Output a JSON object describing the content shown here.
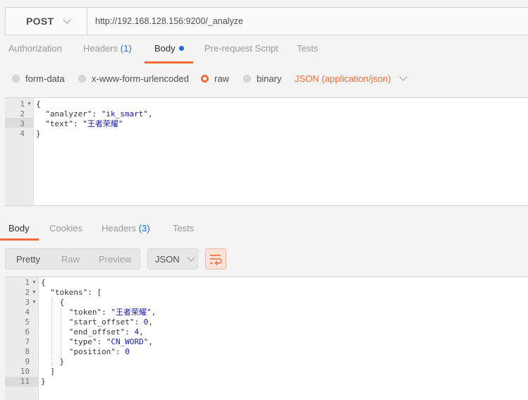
{
  "request": {
    "method": "POST",
    "url": "http://192.168.128.156:9200/_analyze"
  },
  "request_tabs": {
    "authorization": "Authorization",
    "headers": "Headers",
    "headers_count": "(1)",
    "body": "Body",
    "prerequest": "Pre-request Script",
    "tests": "Tests"
  },
  "body_modes": {
    "form_data": "form-data",
    "urlencoded": "x-www-form-urlencoded",
    "raw": "raw",
    "binary": "binary",
    "content_type": "JSON (application/json)"
  },
  "request_body": {
    "line_numbers": [
      "1",
      "2",
      "3",
      "4"
    ],
    "analyzer_key": "\"analyzer\"",
    "analyzer_value": "\"ik_smart\"",
    "text_key": "\"text\"",
    "text_value": "\"王者荣耀\""
  },
  "response_tabs": {
    "body": "Body",
    "cookies": "Cookies",
    "headers": "Headers",
    "headers_count": "(3)",
    "tests": "Tests"
  },
  "response_view": {
    "pretty": "Pretty",
    "raw": "Raw",
    "preview": "Preview",
    "format": "JSON"
  },
  "response_body": {
    "line_numbers": [
      "1",
      "2",
      "3",
      "4",
      "5",
      "6",
      "7",
      "8",
      "9",
      "10",
      "11"
    ],
    "tokens_key": "\"tokens\"",
    "token_key": "\"token\"",
    "token_value": "\"王者荣耀\"",
    "start_offset_key": "\"start_offset\"",
    "start_offset_value": "0",
    "end_offset_key": "\"end_offset\"",
    "end_offset_value": "4",
    "type_key": "\"type\"",
    "type_value": "\"CN_WORD\"",
    "position_key": "\"position\"",
    "position_value": "0"
  },
  "colors": {
    "accent": "#f26b3a",
    "count_blue": "#1e6dd5",
    "json_string": "#1a1aa6"
  }
}
